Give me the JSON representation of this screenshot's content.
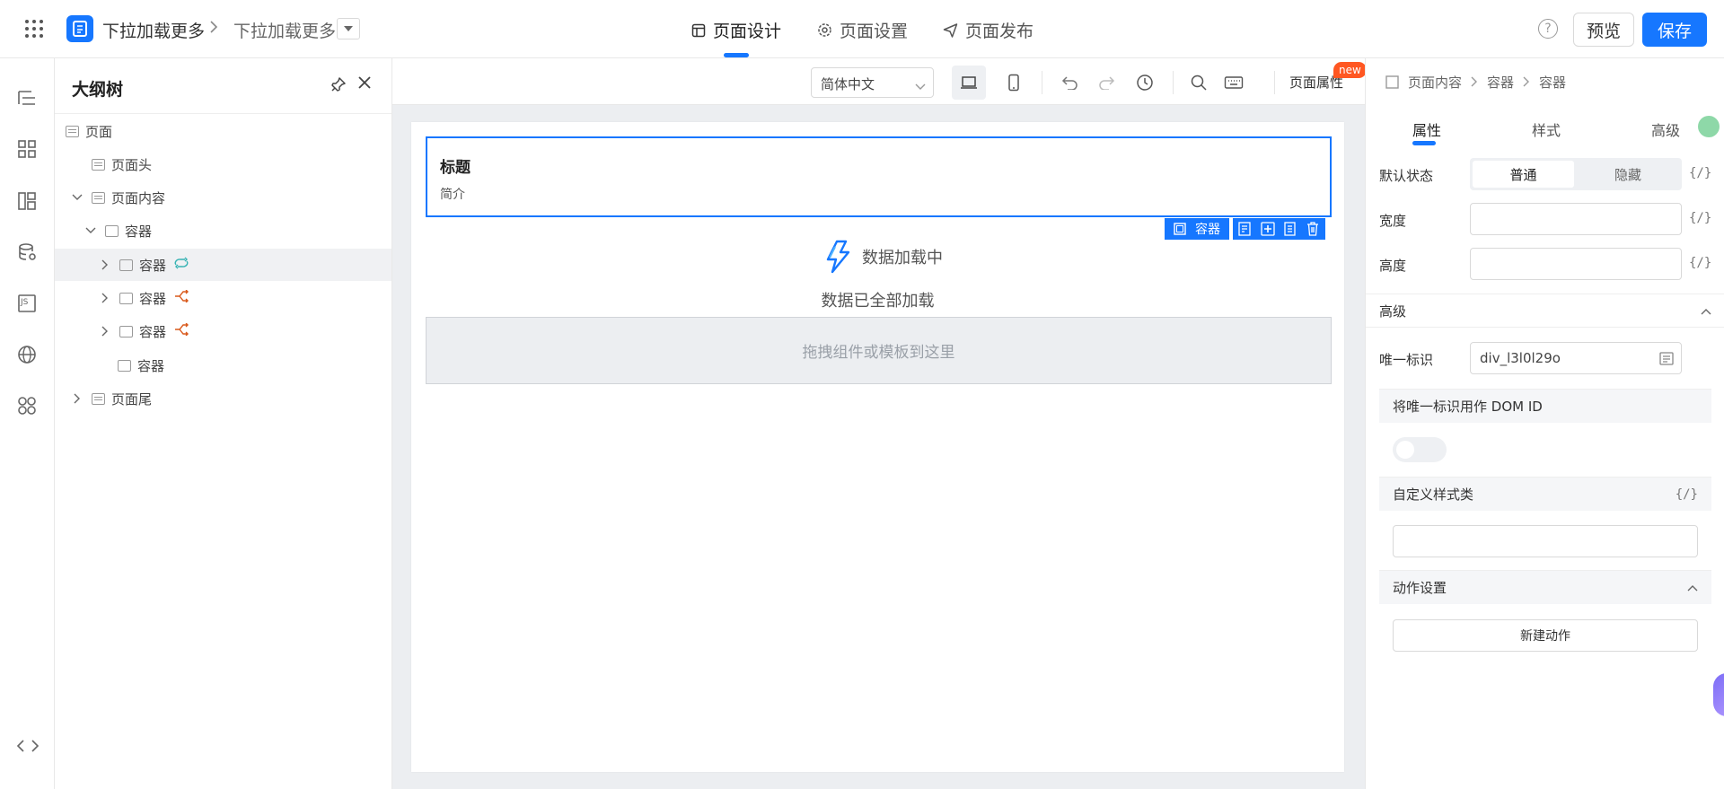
{
  "header": {
    "breadcrumb_app": "下拉加载更多",
    "breadcrumb_page": "下拉加载更多",
    "tabs": [
      {
        "label": "页面设计",
        "icon": "layout-icon"
      },
      {
        "label": "页面设置",
        "icon": "gear-icon"
      },
      {
        "label": "页面发布",
        "icon": "send-icon"
      }
    ],
    "active_tab": "页面设计",
    "help": "?",
    "preview_label": "预览",
    "save_label": "保存",
    "accent_color": "#1677ff"
  },
  "rail": {
    "icons": [
      "outline-tree-icon",
      "components-icon",
      "layout-templates-icon",
      "datasource-icon",
      "js-icon",
      "globe-icon",
      "plugins-icon"
    ],
    "js_label": "JS"
  },
  "outline": {
    "title": "大纲树",
    "nodes": [
      {
        "label": "页面"
      },
      {
        "label": "页面头"
      },
      {
        "label": "页面内容"
      },
      {
        "label": "容器"
      },
      {
        "label": "容器"
      },
      {
        "label": "容器"
      },
      {
        "label": "容器"
      },
      {
        "label": "容器"
      },
      {
        "label": "页面尾"
      }
    ]
  },
  "toolbar": {
    "language": "简体中文",
    "page_attr_label": "页面属性",
    "new_badge": "new"
  },
  "canvas": {
    "hero_title": "标题",
    "hero_subtitle": "简介",
    "selection_tag": "容器",
    "loading_text": "数据加载中",
    "loaded_text": "数据已全部加载",
    "dropzone_text": "拖拽组件或模板到这里"
  },
  "props": {
    "breadcrumb": [
      "页面内容",
      "容器",
      "容器"
    ],
    "tabs": [
      "属性",
      "样式",
      "高级"
    ],
    "active_tab": "属性",
    "default_state_label": "默认状态",
    "state_on": "普通",
    "state_off": "隐藏",
    "width_label": "宽度",
    "height_label": "高度",
    "expr": "{/}",
    "advanced_section": "高级",
    "unique_id_label": "唯一标识",
    "unique_id_value": "div_l3l0l29o",
    "dom_id_label": "将唯一标识用作 DOM ID",
    "dom_id_enabled": false,
    "custom_class_label": "自定义样式类",
    "action_section": "动作设置",
    "new_action_label": "新建动作"
  }
}
